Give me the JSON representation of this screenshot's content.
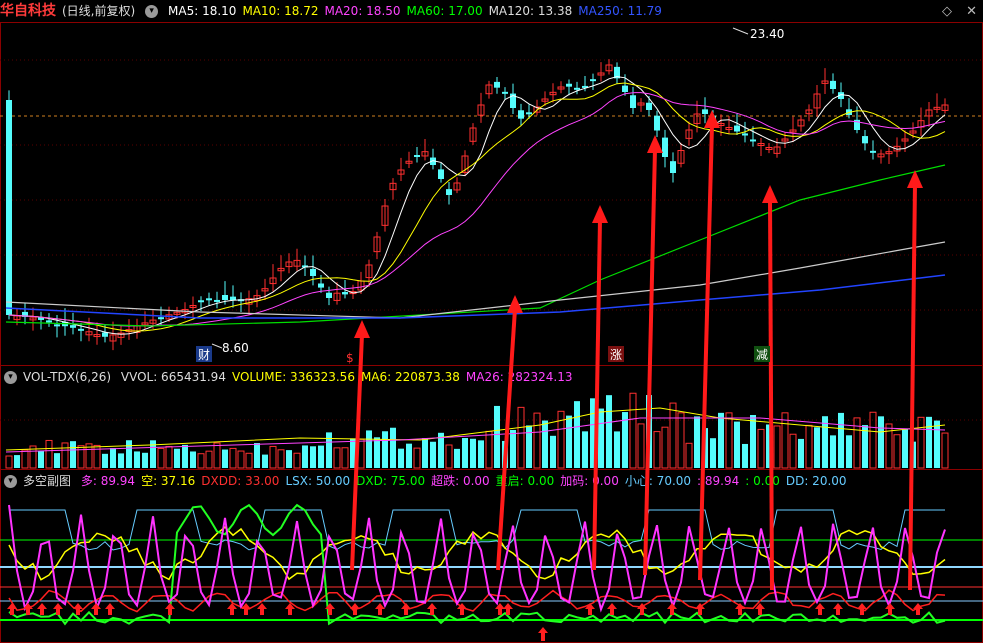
{
  "main_header": {
    "title": "华自科技",
    "mode": "(日线,前复权)",
    "mas": [
      {
        "label": "MA5: 18.10",
        "color": "#ffffff"
      },
      {
        "label": "MA10: 18.72",
        "color": "#ffff00"
      },
      {
        "label": "MA20: 18.50",
        "color": "#ff44ff"
      },
      {
        "label": "MA60: 17.00",
        "color": "#00ff00"
      },
      {
        "label": "MA120: 13.38",
        "color": "#dddddd"
      },
      {
        "label": "MA250: 11.79",
        "color": "#3355ff"
      }
    ]
  },
  "vol_header": {
    "name": "VOL-TDX(6,26)",
    "items": [
      {
        "label": "VVOL: 665431.94",
        "color": "#dddddd"
      },
      {
        "label": "VOLUME: 336323.56",
        "color": "#ffff00"
      },
      {
        "label": "MA6: 220873.38",
        "color": "#ffff00"
      },
      {
        "label": "MA26: 282324.13",
        "color": "#ff44ff"
      }
    ]
  },
  "ind_header": {
    "name": "多空副图",
    "items": [
      {
        "label": "多: 89.94",
        "color": "#ff44ff"
      },
      {
        "label": "空: 37.16",
        "color": "#ffff00"
      },
      {
        "label": "DXDD: 33.00",
        "color": "#ff3030"
      },
      {
        "label": "LSX: 50.00",
        "color": "#66ccff"
      },
      {
        "label": "DXD: 75.00",
        "color": "#00ff00"
      },
      {
        "label": "超跌: 0.00",
        "color": "#ff44ff"
      },
      {
        "label": "重启: 0.00",
        "color": "#00ff00"
      },
      {
        "label": "加码: 0.00",
        "color": "#ff44ff"
      },
      {
        "label": "小心: 70.00",
        "color": "#66ccff"
      },
      {
        "label": ": 89.94",
        "color": "#ff44ff"
      },
      {
        "label": ": 0.00",
        "color": "#00ff00"
      },
      {
        "label": "DD: 20.00",
        "color": "#66ccff"
      }
    ]
  },
  "annotations": {
    "high": "23.40",
    "low": "8.60",
    "tag_cai": "财",
    "tag_dollar": "$",
    "tag_zhang": "涨",
    "tag_jian": "减"
  },
  "icons": [
    "diamond-icon",
    "close-icon"
  ]
}
